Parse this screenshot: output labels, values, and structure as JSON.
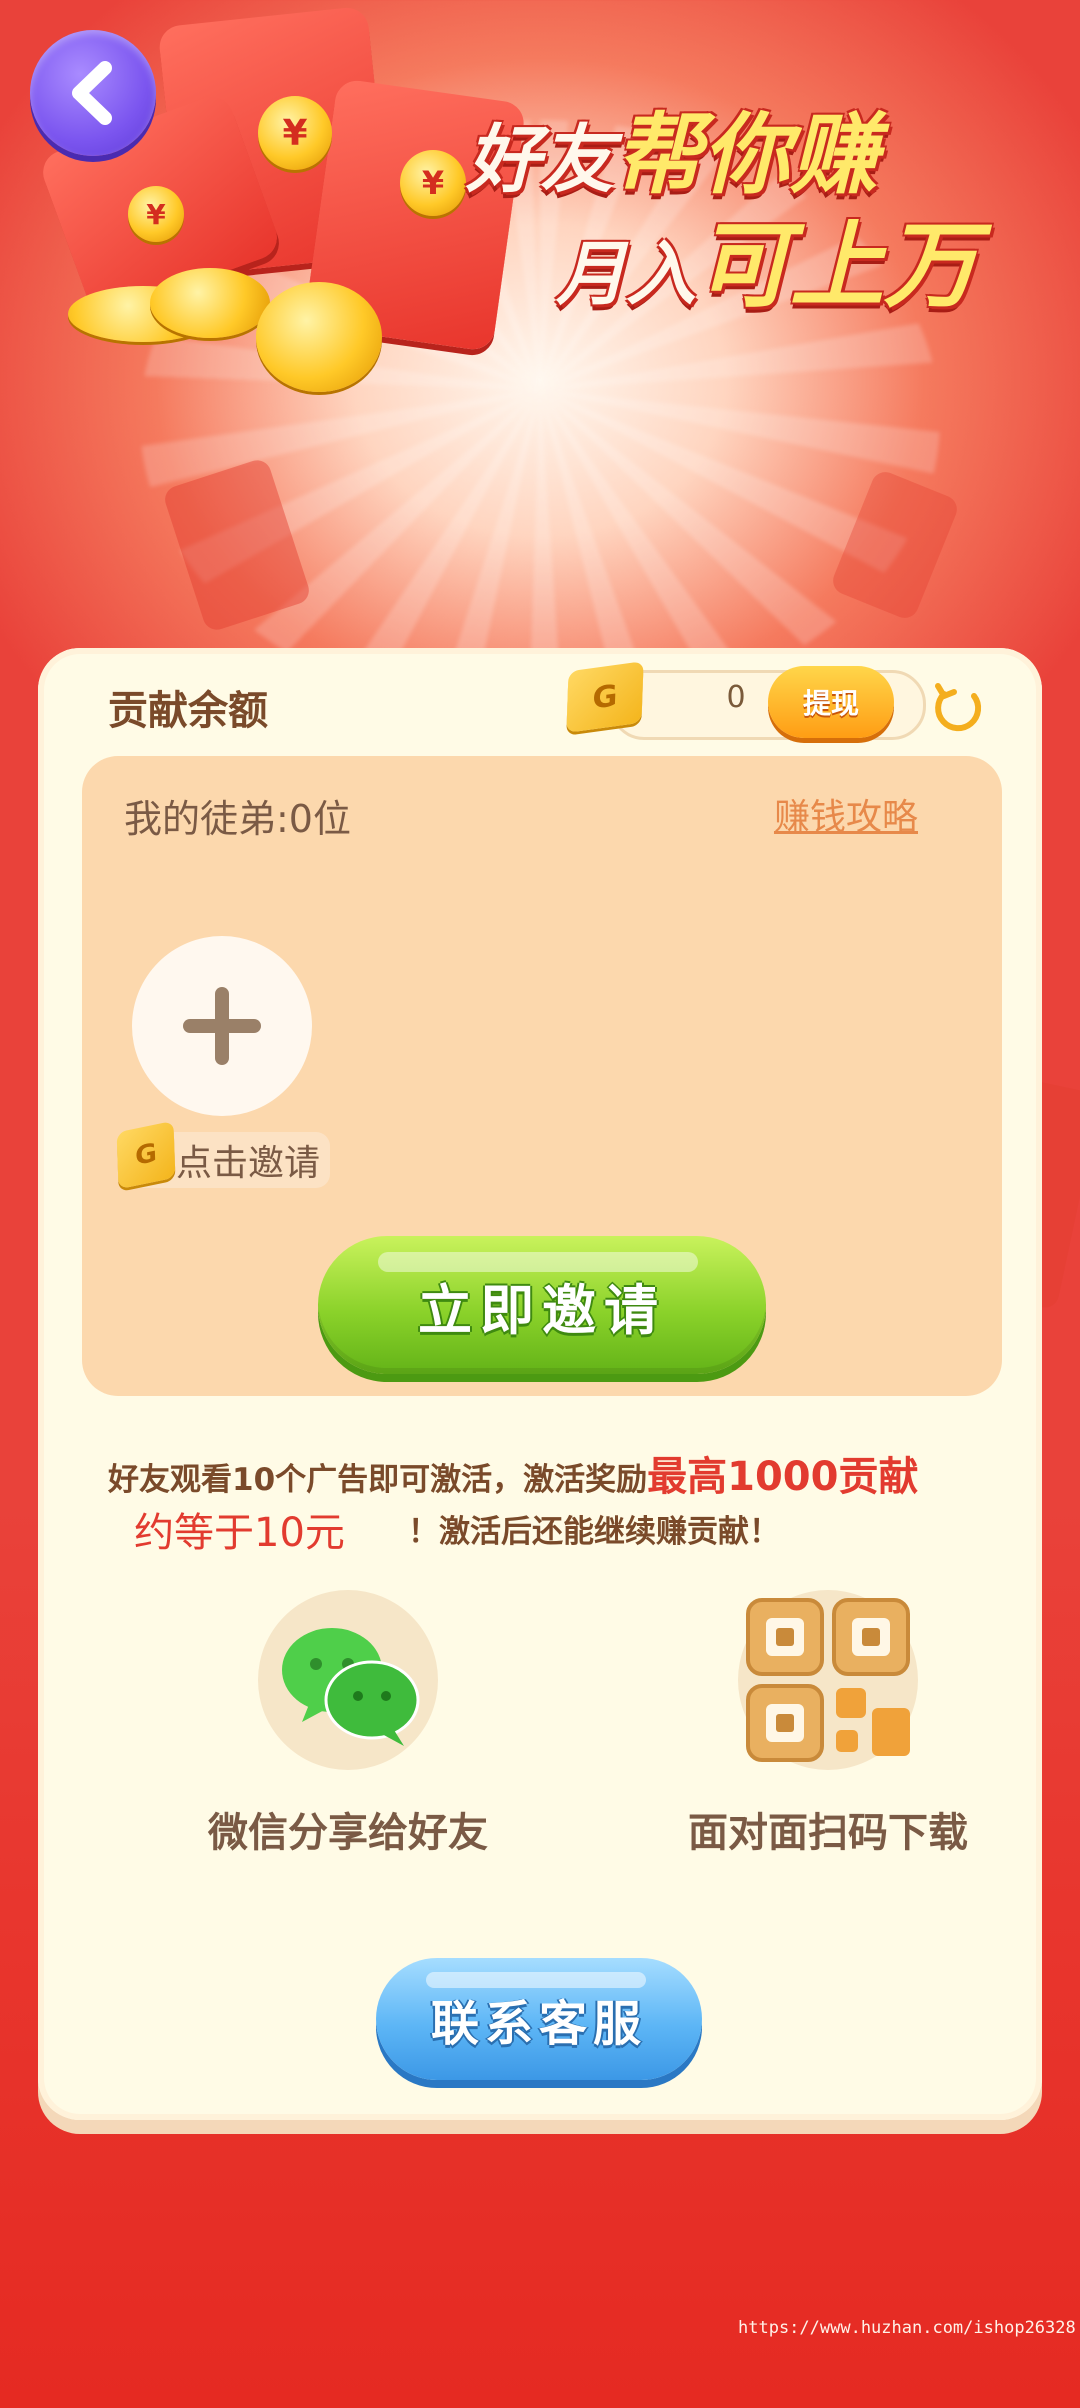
{
  "header": {
    "headline_line1_a": "好友",
    "headline_line1_b": "帮你赚",
    "headline_line2_a": "月入",
    "headline_line2_b": "可上万",
    "coin_symbol": "¥"
  },
  "card": {
    "title": "贡献余额",
    "balance_badge": "G",
    "balance_value": "0",
    "withdraw_label": "提现",
    "disciples_label": "我的徒弟:0位",
    "strategy_link": "赚钱攻略",
    "invite_badge": "G",
    "invite_tag": "点击邀请",
    "invite_now": "立即邀请",
    "desc_part1": "好友观看10个广告即可激活，激活奖励",
    "desc_highlight": "最高1000贡献",
    "desc_line2_red": "约等于10元",
    "desc_line2_rest": "！激活后还能继续赚贡献！",
    "share_wechat": "微信分享给好友",
    "share_qr": "面对面扫码下载",
    "contact": "联系客服"
  },
  "watermark": "https://www.huzhan.com/ishop26328",
  "colors": {
    "accent_red": "#e23b2f",
    "brown_text": "#7a4a2a",
    "green_button": "#8bd22a",
    "blue_button": "#5db6f6",
    "back_purple": "#7b55ef"
  }
}
